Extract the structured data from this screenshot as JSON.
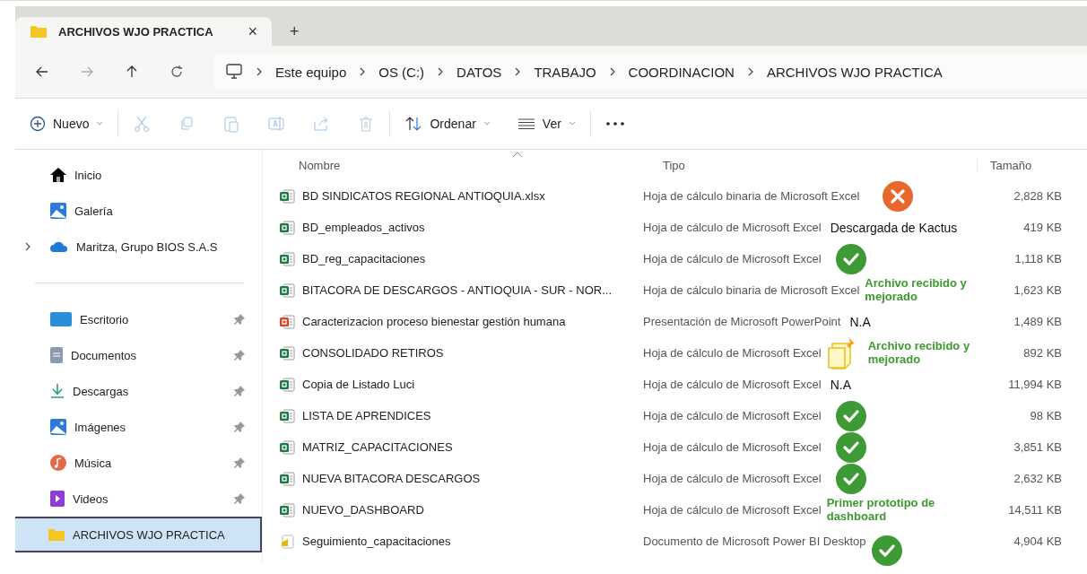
{
  "tab": {
    "title": "ARCHIVOS WJO PRACTICA",
    "close": "×",
    "new": "+"
  },
  "breadcrumbs": [
    "Este equipo",
    "OS (C:)",
    "DATOS",
    "TRABAJO",
    "COORDINACION",
    "ARCHIVOS WJO PRACTICA"
  ],
  "toolbar": {
    "new": "Nuevo",
    "sort": "Ordenar",
    "view": "Ver"
  },
  "sidebar": {
    "sections": [
      {
        "items": [
          {
            "label": "Inicio",
            "pinned": false,
            "expandable": false,
            "selected": false
          },
          {
            "label": "Galería",
            "pinned": false,
            "expandable": false,
            "selected": false
          },
          {
            "label": "Maritza, Grupo BIOS S.A.S",
            "pinned": false,
            "expandable": true,
            "selected": false
          }
        ]
      },
      {
        "items": [
          {
            "label": "Escritorio",
            "pinned": true,
            "expandable": false,
            "selected": false
          },
          {
            "label": "Documentos",
            "pinned": true,
            "expandable": false,
            "selected": false
          },
          {
            "label": "Descargas",
            "pinned": true,
            "expandable": false,
            "selected": false
          },
          {
            "label": "Imágenes",
            "pinned": true,
            "expandable": false,
            "selected": false
          },
          {
            "label": "Música",
            "pinned": true,
            "expandable": false,
            "selected": false
          },
          {
            "label": "Videos",
            "pinned": true,
            "expandable": false,
            "selected": false
          },
          {
            "label": "ARCHIVOS WJO PRACTICA",
            "pinned": false,
            "expandable": false,
            "selected": true
          }
        ]
      }
    ]
  },
  "table": {
    "columns": [
      "Nombre",
      "Tipo",
      "Tamaño"
    ],
    "rows": [
      {
        "name": "BD SINDICATOS REGIONAL ANTIOQUIA.xlsx",
        "kind": "excel",
        "type": "Hoja de cálculo binaria de Microsoft Excel",
        "size": "2,828 KB",
        "annotation": {
          "kind": "cross"
        }
      },
      {
        "name": "BD_empleados_activos",
        "kind": "excel",
        "type": "Hoja de cálculo de Microsoft Excel",
        "size": "419 KB",
        "annotation": {
          "kind": "label",
          "text": "Descargada de Kactus"
        }
      },
      {
        "name": "BD_reg_capacitaciones",
        "kind": "excel",
        "type": "Hoja de cálculo de Microsoft Excel",
        "size": "1,118 KB",
        "annotation": {
          "kind": "check"
        }
      },
      {
        "name": "BITACORA DE DESCARGOS - ANTIOQUIA - SUR - NOR...",
        "kind": "excel",
        "type": "Hoja de cálculo binaria de Microsoft Excel",
        "size": "1,623 KB",
        "annotation": {
          "kind": "note",
          "text": "Archivo recibido y mejorado"
        }
      },
      {
        "name": "Caracterizacion proceso bienestar  gestión humana",
        "kind": "powerpoint",
        "type": "Presentación de Microsoft PowerPoint",
        "size": "1,489 KB",
        "annotation": {
          "kind": "label",
          "text": "N.A"
        }
      },
      {
        "name": "CONSOLIDADO RETIROS",
        "kind": "excel",
        "type": "Hoja de cálculo de Microsoft Excel",
        "size": "892 KB",
        "annotation": {
          "kind": "sticky-note",
          "text": "Archivo recibido y mejorado"
        }
      },
      {
        "name": "Copia de Listado Luci",
        "kind": "excel",
        "type": "Hoja de cálculo de Microsoft Excel",
        "size": "11,994 KB",
        "annotation": {
          "kind": "label",
          "text": "N.A"
        }
      },
      {
        "name": "LISTA DE APRENDICES",
        "kind": "excel",
        "type": "Hoja de cálculo de Microsoft Excel",
        "size": "98 KB",
        "annotation": {
          "kind": "check"
        }
      },
      {
        "name": "MATRIZ_CAPACITACIONES",
        "kind": "excel",
        "type": "Hoja de cálculo de Microsoft Excel",
        "size": "3,851 KB",
        "annotation": {
          "kind": "check"
        }
      },
      {
        "name": "NUEVA BITACORA DESCARGOS",
        "kind": "excel",
        "type": "Hoja de cálculo de Microsoft Excel",
        "size": "2,632 KB",
        "annotation": {
          "kind": "check"
        }
      },
      {
        "name": "NUEVO_DASHBOARD",
        "kind": "excel",
        "type": "Hoja de cálculo de Microsoft Excel",
        "size": "14,511 KB",
        "annotation": {
          "kind": "note",
          "text": "Primer prototipo de dashboard"
        }
      },
      {
        "name": "Seguimiento_capacitaciones",
        "kind": "powerbi",
        "type": "Documento de Microsoft Power BI Desktop",
        "size": "4,904 KB",
        "annotation": {
          "kind": "check-low"
        }
      }
    ]
  }
}
